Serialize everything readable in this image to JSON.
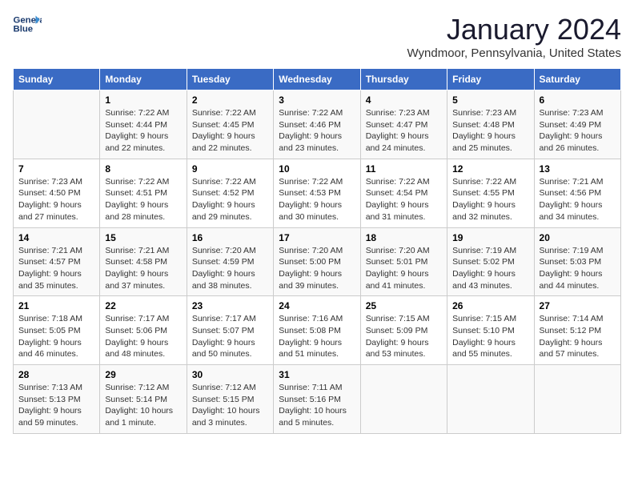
{
  "logo": {
    "line1": "General",
    "line2": "Blue"
  },
  "title": "January 2024",
  "subtitle": "Wyndmoor, Pennsylvania, United States",
  "headers": [
    "Sunday",
    "Monday",
    "Tuesday",
    "Wednesday",
    "Thursday",
    "Friday",
    "Saturday"
  ],
  "weeks": [
    [
      {
        "day": "",
        "details": ""
      },
      {
        "day": "1",
        "details": "Sunrise: 7:22 AM\nSunset: 4:44 PM\nDaylight: 9 hours\nand 22 minutes."
      },
      {
        "day": "2",
        "details": "Sunrise: 7:22 AM\nSunset: 4:45 PM\nDaylight: 9 hours\nand 22 minutes."
      },
      {
        "day": "3",
        "details": "Sunrise: 7:22 AM\nSunset: 4:46 PM\nDaylight: 9 hours\nand 23 minutes."
      },
      {
        "day": "4",
        "details": "Sunrise: 7:23 AM\nSunset: 4:47 PM\nDaylight: 9 hours\nand 24 minutes."
      },
      {
        "day": "5",
        "details": "Sunrise: 7:23 AM\nSunset: 4:48 PM\nDaylight: 9 hours\nand 25 minutes."
      },
      {
        "day": "6",
        "details": "Sunrise: 7:23 AM\nSunset: 4:49 PM\nDaylight: 9 hours\nand 26 minutes."
      }
    ],
    [
      {
        "day": "7",
        "details": "Sunrise: 7:23 AM\nSunset: 4:50 PM\nDaylight: 9 hours\nand 27 minutes."
      },
      {
        "day": "8",
        "details": "Sunrise: 7:22 AM\nSunset: 4:51 PM\nDaylight: 9 hours\nand 28 minutes."
      },
      {
        "day": "9",
        "details": "Sunrise: 7:22 AM\nSunset: 4:52 PM\nDaylight: 9 hours\nand 29 minutes."
      },
      {
        "day": "10",
        "details": "Sunrise: 7:22 AM\nSunset: 4:53 PM\nDaylight: 9 hours\nand 30 minutes."
      },
      {
        "day": "11",
        "details": "Sunrise: 7:22 AM\nSunset: 4:54 PM\nDaylight: 9 hours\nand 31 minutes."
      },
      {
        "day": "12",
        "details": "Sunrise: 7:22 AM\nSunset: 4:55 PM\nDaylight: 9 hours\nand 32 minutes."
      },
      {
        "day": "13",
        "details": "Sunrise: 7:21 AM\nSunset: 4:56 PM\nDaylight: 9 hours\nand 34 minutes."
      }
    ],
    [
      {
        "day": "14",
        "details": "Sunrise: 7:21 AM\nSunset: 4:57 PM\nDaylight: 9 hours\nand 35 minutes."
      },
      {
        "day": "15",
        "details": "Sunrise: 7:21 AM\nSunset: 4:58 PM\nDaylight: 9 hours\nand 37 minutes."
      },
      {
        "day": "16",
        "details": "Sunrise: 7:20 AM\nSunset: 4:59 PM\nDaylight: 9 hours\nand 38 minutes."
      },
      {
        "day": "17",
        "details": "Sunrise: 7:20 AM\nSunset: 5:00 PM\nDaylight: 9 hours\nand 39 minutes."
      },
      {
        "day": "18",
        "details": "Sunrise: 7:20 AM\nSunset: 5:01 PM\nDaylight: 9 hours\nand 41 minutes."
      },
      {
        "day": "19",
        "details": "Sunrise: 7:19 AM\nSunset: 5:02 PM\nDaylight: 9 hours\nand 43 minutes."
      },
      {
        "day": "20",
        "details": "Sunrise: 7:19 AM\nSunset: 5:03 PM\nDaylight: 9 hours\nand 44 minutes."
      }
    ],
    [
      {
        "day": "21",
        "details": "Sunrise: 7:18 AM\nSunset: 5:05 PM\nDaylight: 9 hours\nand 46 minutes."
      },
      {
        "day": "22",
        "details": "Sunrise: 7:17 AM\nSunset: 5:06 PM\nDaylight: 9 hours\nand 48 minutes."
      },
      {
        "day": "23",
        "details": "Sunrise: 7:17 AM\nSunset: 5:07 PM\nDaylight: 9 hours\nand 50 minutes."
      },
      {
        "day": "24",
        "details": "Sunrise: 7:16 AM\nSunset: 5:08 PM\nDaylight: 9 hours\nand 51 minutes."
      },
      {
        "day": "25",
        "details": "Sunrise: 7:15 AM\nSunset: 5:09 PM\nDaylight: 9 hours\nand 53 minutes."
      },
      {
        "day": "26",
        "details": "Sunrise: 7:15 AM\nSunset: 5:10 PM\nDaylight: 9 hours\nand 55 minutes."
      },
      {
        "day": "27",
        "details": "Sunrise: 7:14 AM\nSunset: 5:12 PM\nDaylight: 9 hours\nand 57 minutes."
      }
    ],
    [
      {
        "day": "28",
        "details": "Sunrise: 7:13 AM\nSunset: 5:13 PM\nDaylight: 9 hours\nand 59 minutes."
      },
      {
        "day": "29",
        "details": "Sunrise: 7:12 AM\nSunset: 5:14 PM\nDaylight: 10 hours\nand 1 minute."
      },
      {
        "day": "30",
        "details": "Sunrise: 7:12 AM\nSunset: 5:15 PM\nDaylight: 10 hours\nand 3 minutes."
      },
      {
        "day": "31",
        "details": "Sunrise: 7:11 AM\nSunset: 5:16 PM\nDaylight: 10 hours\nand 5 minutes."
      },
      {
        "day": "",
        "details": ""
      },
      {
        "day": "",
        "details": ""
      },
      {
        "day": "",
        "details": ""
      }
    ]
  ]
}
